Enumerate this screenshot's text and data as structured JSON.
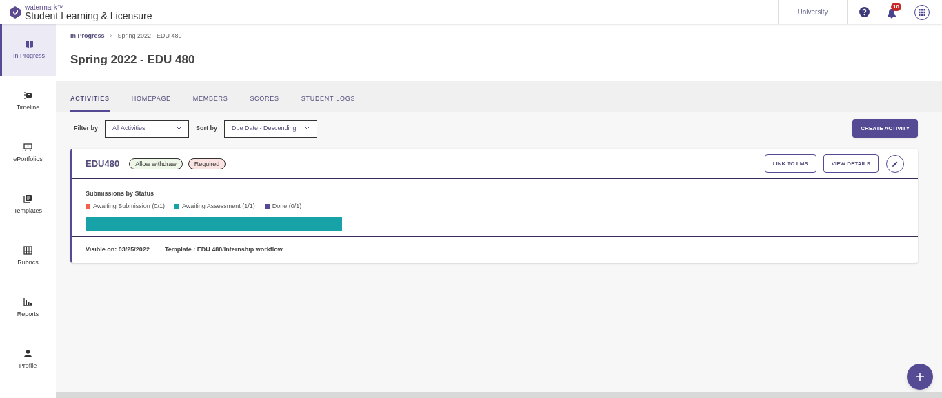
{
  "header": {
    "brand_small": "watermark™",
    "brand": "Student Learning & Licensure",
    "institution": "University",
    "notification_count": "10"
  },
  "sidebar": {
    "items": [
      {
        "label": "In Progress",
        "kind": "book",
        "selected": true
      },
      {
        "label": "Timeline",
        "kind": "timeline",
        "selected": false
      },
      {
        "label": "ePortfolios",
        "kind": "easel",
        "selected": false
      },
      {
        "label": "Templates",
        "kind": "templates",
        "selected": false
      },
      {
        "label": "Rubrics",
        "kind": "grid",
        "selected": false
      },
      {
        "label": "Reports",
        "kind": "bars",
        "selected": false
      },
      {
        "label": "Profile",
        "kind": "person",
        "selected": false
      }
    ]
  },
  "breadcrumb": [
    "In Progress",
    "›",
    "Spring 2022 - EDU 480"
  ],
  "page_title": "Spring 2022 - EDU 480",
  "tabs": [
    {
      "label": "ACTIVITIES",
      "selected": true
    },
    {
      "label": "HOMEPAGE",
      "selected": false
    },
    {
      "label": "MEMBERS",
      "selected": false
    },
    {
      "label": "SCORES",
      "selected": false
    },
    {
      "label": "STUDENT LOGS",
      "selected": false
    }
  ],
  "filters": [
    {
      "label": "Filter by",
      "value": "All Activities"
    },
    {
      "label": "Sort by",
      "value": "Due Date - Descending"
    }
  ],
  "create_button": "CREATE ACTIVITY",
  "activity": {
    "title": "EDU480",
    "tags": [
      {
        "label": "Allow withdraw",
        "color": "#eef6e8"
      },
      {
        "label": "Required",
        "color": "#fbe3e1"
      }
    ],
    "buttons": [
      "LINK TO LMS",
      "VIEW DETAILS"
    ],
    "chart_title": "Submissions by Status",
    "statuses": [
      {
        "label": "Awaiting Submission (0/1)",
        "color": "#f4604c"
      },
      {
        "label": "Awaiting Assessment (1/1)",
        "color": "#17a2a8"
      },
      {
        "label": "Done (0/1)",
        "color": "#544b94"
      }
    ],
    "status_bar": [
      {
        "color": "#17a2a8"
      }
    ],
    "visible_on": "Visible on: 03/25/2022",
    "template": "Template : EDU 480/Internship workflow"
  }
}
